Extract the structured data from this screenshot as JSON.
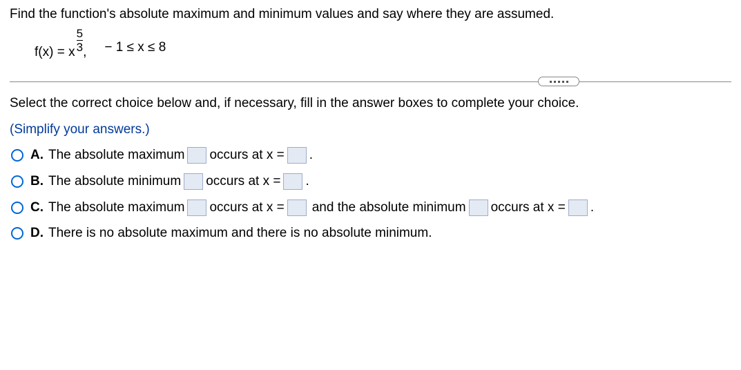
{
  "question": "Find the function's absolute maximum and minimum values and say where they are assumed.",
  "formula": {
    "fx_prefix": "f(x) = x",
    "exp_num": "5",
    "exp_den": "3",
    "comma": ",",
    "domain": "− 1 ≤ x ≤ 8"
  },
  "instruction": "Select the correct choice below and, if necessary, fill in the answer boxes to complete your choice.",
  "simplify": "(Simplify your answers.)",
  "choices": {
    "A": {
      "letter": "A.",
      "part1": "The absolute maximum",
      "part2": "occurs at x =",
      "period": "."
    },
    "B": {
      "letter": "B.",
      "part1": "The absolute minimum",
      "part2": "occurs at x =",
      "period": "."
    },
    "C": {
      "letter": "C.",
      "part1": "The absolute maximum",
      "part2": "occurs at x =",
      "part3": "and the absolute minimum",
      "part4": "occurs at x =",
      "period": "."
    },
    "D": {
      "letter": "D.",
      "text": "There is no absolute maximum and there is no absolute minimum."
    }
  }
}
